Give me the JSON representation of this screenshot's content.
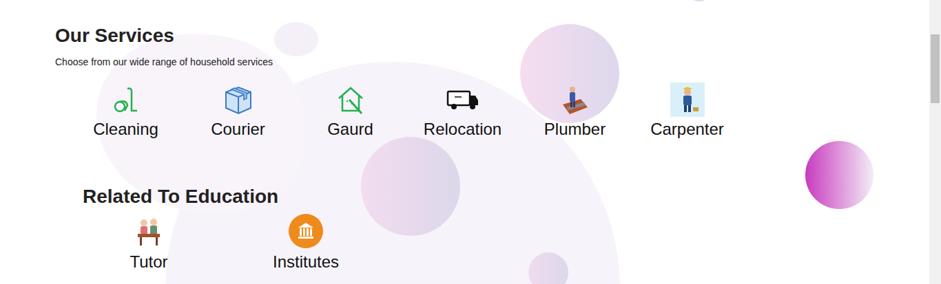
{
  "title": "Our Services",
  "subtitle": "Choose from our wide range of household services",
  "services": [
    {
      "label": "Cleaning"
    },
    {
      "label": "Courier"
    },
    {
      "label": "Gaurd"
    },
    {
      "label": "Relocation"
    },
    {
      "label": "Plumber"
    },
    {
      "label": "Carpenter"
    }
  ],
  "education": {
    "title": "Related To Education",
    "items": [
      {
        "label": "Tutor"
      },
      {
        "label": "Institutes"
      }
    ]
  }
}
